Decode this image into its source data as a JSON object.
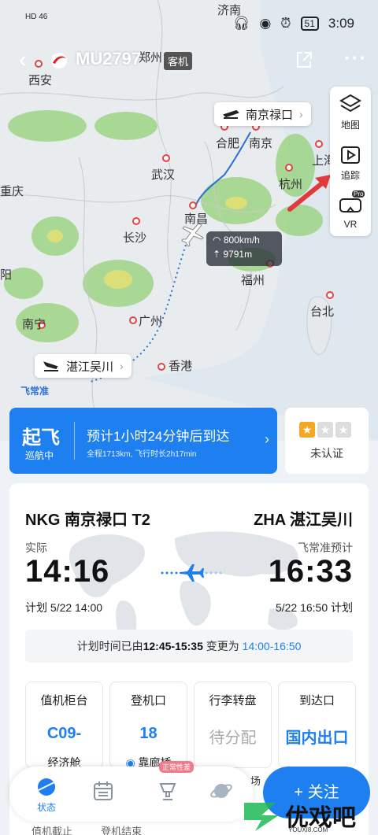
{
  "statusbar": {
    "signal_left": "HD 46",
    "time": "3:09",
    "battery": "51"
  },
  "nav": {
    "flight_no": "MU2797",
    "aircraft_type": "客机"
  },
  "map": {
    "cities": [
      "济南",
      "郑州",
      "西安",
      "合肥",
      "南京",
      "武汉",
      "杭州",
      "上海",
      "重庆",
      "南昌",
      "长沙",
      "福州",
      "台北",
      "南宁",
      "广州",
      "香港",
      "阳"
    ],
    "origin_label": "南京禄口",
    "dest_label": "湛江吴川",
    "speed": "800km/h",
    "altitude": "9791m",
    "brand": "飞常准"
  },
  "tools": {
    "map_label": "地图",
    "track_label": "追踪",
    "vr_label": "VR",
    "vr_badge": "Pro"
  },
  "status": {
    "state": "起飞",
    "sub_state": "巡航中",
    "eta_text": "预计1小时24分钟后到达",
    "meta": "全程1713km,  飞行时长2h17min"
  },
  "cert": {
    "stars": 1,
    "label": "未认证"
  },
  "route": {
    "from": "NKG 南京禄口 T2",
    "to": "ZHA 湛江吴川",
    "left_label": "实际",
    "right_label": "飞常准预计",
    "dep_time": "14:16",
    "arr_time": "16:33",
    "dep_plan": "计划  5/22 14:00",
    "arr_plan": "5/22 16:50  计划",
    "change_prefix": "计划时间已由",
    "change_old": "12:45-15:35",
    "change_mid": " 变更为 ",
    "change_new": "14:00-16:50"
  },
  "tiles": [
    {
      "title": "值机柜台",
      "value": "C09-",
      "sub": "经济舱"
    },
    {
      "title": "登机口",
      "value": "18",
      "sub": "靠廊桥"
    },
    {
      "title": "行李转盘",
      "value": "待分配",
      "sub": ""
    },
    {
      "title": "到达口",
      "value": "国内出口",
      "sub": ""
    }
  ],
  "bottombar": {
    "status_label": "状态",
    "badge": "正常性差",
    "follow": "+ 关注",
    "peek_left": "值机截止",
    "peek_right": "登机结束",
    "peek_scene": "场"
  },
  "watermark": {
    "text": "优戏吧",
    "sub": "YOUXI8.COM"
  },
  "colors": {
    "accent": "#1d7ff0",
    "marker": "#e04444",
    "rain_green": "#8fd070",
    "rain_yellow": "#e8e070"
  }
}
